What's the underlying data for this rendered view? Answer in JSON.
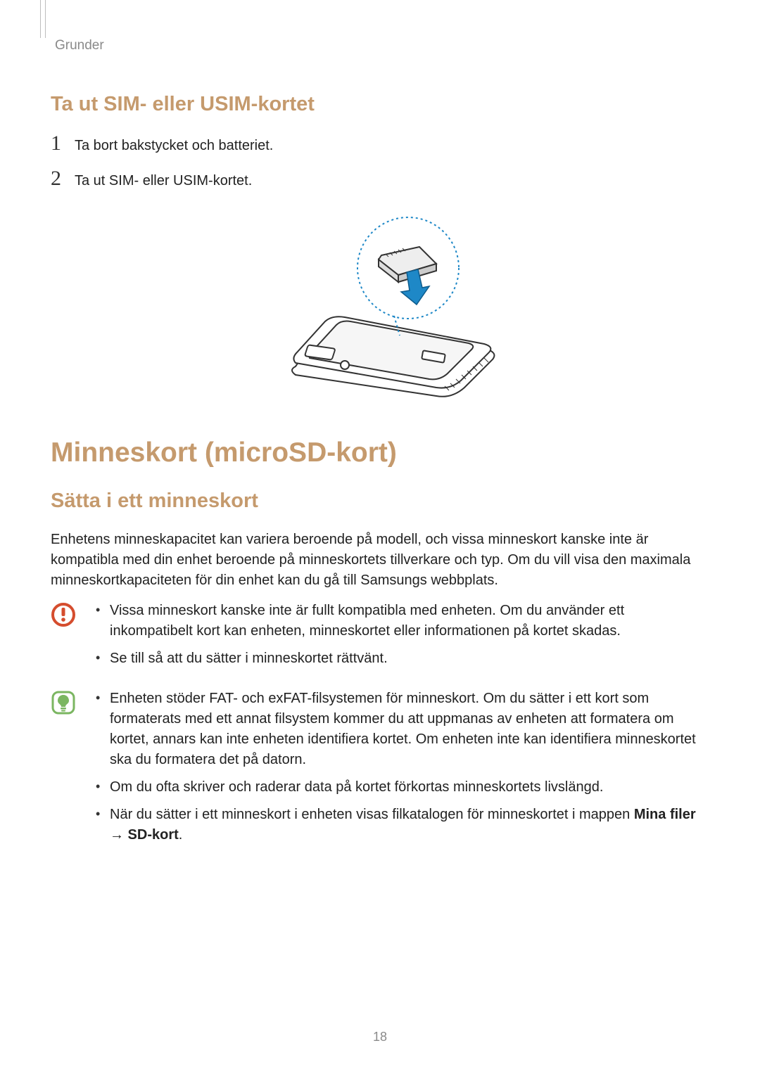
{
  "header": {
    "breadcrumb": "Grunder"
  },
  "section1": {
    "title": "Ta ut SIM- eller USIM-kortet",
    "steps": [
      "Ta bort bakstycket och batteriet.",
      "Ta ut SIM- eller USIM-kortet."
    ]
  },
  "chapter": {
    "title": "Minneskort (microSD-kort)"
  },
  "section2": {
    "title": "Sätta i ett minneskort",
    "intro": "Enhetens minneskapacitet kan variera beroende på modell, och vissa minneskort kanske inte är kompatibla med din enhet beroende på minneskortets tillverkare och typ. Om du vill visa den maximala minneskortkapaciteten för din enhet kan du gå till Samsungs webbplats.",
    "warning_bullets": [
      "Vissa minneskort kanske inte är fullt kompatibla med enheten. Om du använder ett inkompatibelt kort kan enheten, minneskortet eller informationen på kortet skadas.",
      "Se till så att du sätter i minneskortet rättvänt."
    ],
    "info_bullets": [
      "Enheten stöder FAT- och exFAT-filsystemen för minneskort. Om du sätter i ett kort som formaterats med ett annat filsystem kommer du att uppmanas av enheten att formatera om kortet, annars kan inte enheten identifiera kortet. Om enheten inte kan identifiera minneskortet ska du formatera det på datorn.",
      "Om du ofta skriver och raderar data på kortet förkortas minneskortets livslängd."
    ],
    "info_bullet3_prefix": "När du sätter i ett minneskort i enheten visas filkatalogen för minneskortet i mappen ",
    "info_bullet3_bold": "Mina filer → SD-kort",
    "info_bullet3_suffix": "."
  },
  "page_number": "18"
}
